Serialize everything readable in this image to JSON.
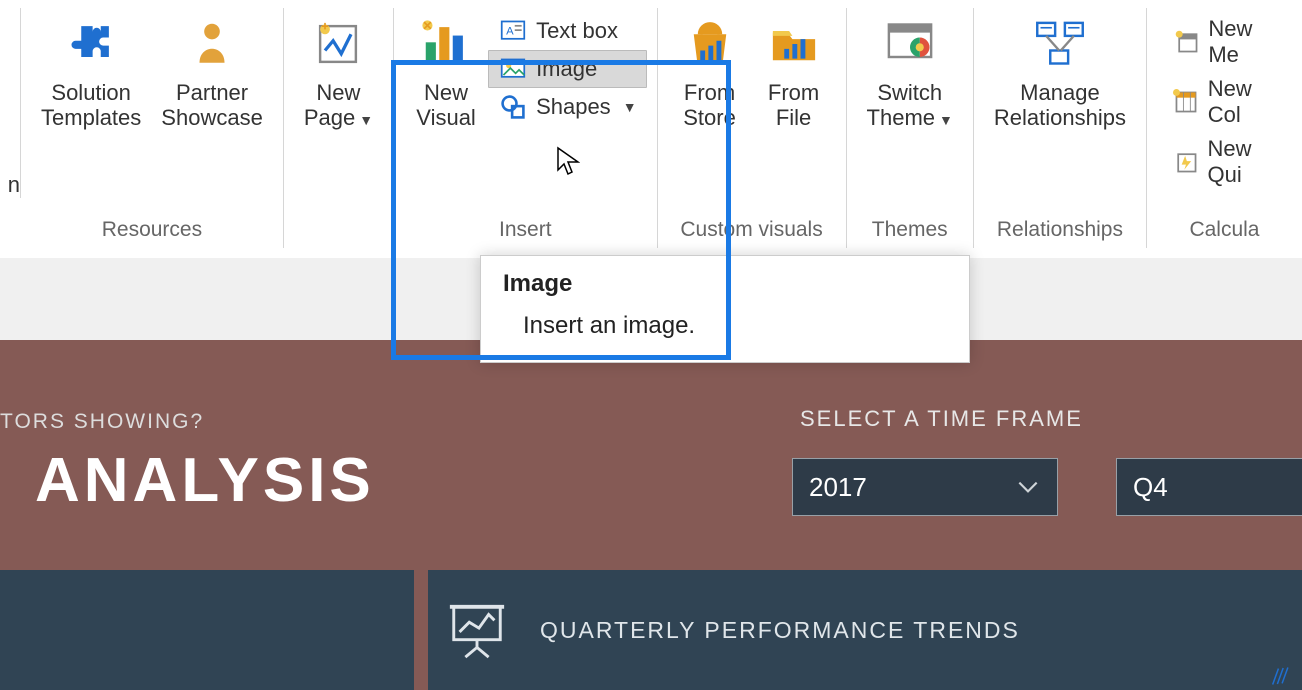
{
  "ribbon": {
    "groups": {
      "resources": {
        "label": "Resources",
        "solution_templates": "Solution\nTemplates",
        "partner_showcase": "Partner\nShowcase"
      },
      "report": {
        "new_page": "New\nPage"
      },
      "insert": {
        "label": "Insert",
        "new_visual": "New\nVisual",
        "text_box": "Text box",
        "image": "Image",
        "shapes": "Shapes"
      },
      "custom_visuals": {
        "label": "Custom visuals",
        "from_store": "From\nStore",
        "from_file": "From\nFile"
      },
      "themes": {
        "label": "Themes",
        "switch_theme": "Switch\nTheme"
      },
      "relationships": {
        "label": "Relationships",
        "manage": "Manage\nRelationships"
      },
      "calculations": {
        "label": "Calcula",
        "new_measure": "New Me",
        "new_column": "New Col",
        "new_quick": "New Qui"
      }
    },
    "cut_left_suffix": "n"
  },
  "tooltip": {
    "title": "Image",
    "desc": "Insert an image."
  },
  "canvas": {
    "question_suffix": "TORS SHOWING?",
    "title_suffix": "ANALYSIS",
    "select_label": "SELECT A TIME FRAME",
    "year": "2017",
    "quarter": "Q4",
    "band_title": "QUARTERLY PERFORMANCE TRENDS"
  }
}
